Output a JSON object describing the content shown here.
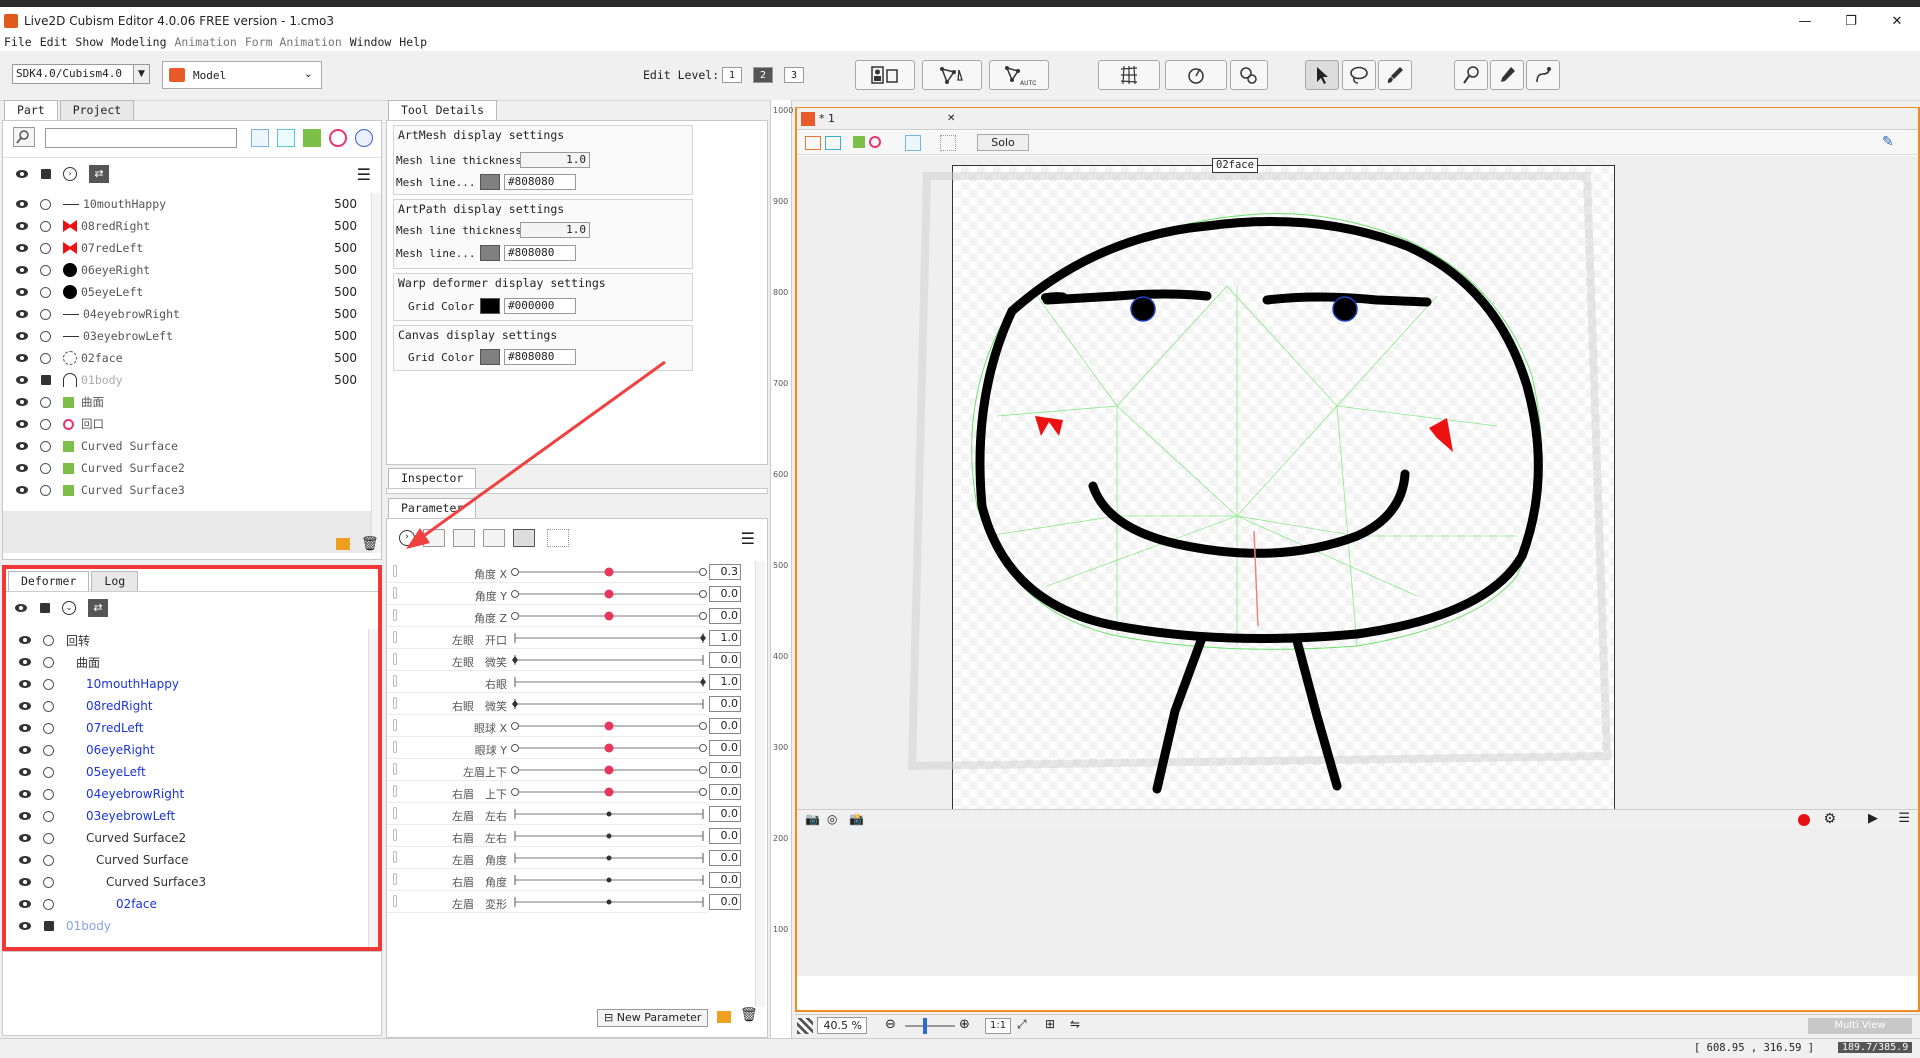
{
  "window": {
    "title": "Live2D Cubism Editor 4.0.06   FREE version  - 1.cmo3",
    "minimize": "—",
    "maximize": "❐",
    "close": "✕"
  },
  "menu": [
    "File",
    "Edit",
    "Show",
    "Modeling",
    "Animation",
    "Form Animation",
    "Window",
    "Help"
  ],
  "toolbar": {
    "sdk_select": "SDK4.0/Cubism4.0",
    "mode_select": "Model",
    "edit_level_label": "Edit Level:",
    "edit_levels": [
      "1",
      "2",
      "3"
    ],
    "edit_level_selected": "2"
  },
  "part_panel": {
    "tabs": [
      "Part",
      "Project"
    ],
    "rows": [
      {
        "name": "10mouthHappy",
        "value": "500",
        "icon": "mouth-stroke-icon"
      },
      {
        "name": "08redRight",
        "value": "500",
        "icon": "red-mark-icon"
      },
      {
        "name": "07redLeft",
        "value": "500",
        "icon": "red-mark-icon"
      },
      {
        "name": "06eyeRight",
        "value": "500",
        "icon": "black-dot-icon"
      },
      {
        "name": "05eyeLeft",
        "value": "500",
        "icon": "black-dot-icon"
      },
      {
        "name": "04eyebrowRight",
        "value": "500",
        "icon": "stroke-icon"
      },
      {
        "name": "03eyebrowLeft",
        "value": "500",
        "icon": "stroke-icon"
      },
      {
        "name": "02face",
        "value": "500",
        "icon": "dashed-circle-icon"
      },
      {
        "name": "01body",
        "value": "500",
        "icon": "body-icon"
      },
      {
        "name": "曲面",
        "value": "",
        "icon": "warp-deformer-icon"
      },
      {
        "name": "回口",
        "value": "",
        "icon": "rotation-deformer-icon"
      },
      {
        "name": "Curved Surface",
        "value": "",
        "icon": "warp-deformer-icon"
      },
      {
        "name": "Curved Surface2",
        "value": "",
        "icon": "warp-deformer-icon"
      },
      {
        "name": "Curved Surface3",
        "value": "",
        "icon": "warp-deformer-icon"
      }
    ]
  },
  "deformer_panel": {
    "tabs": [
      "Deformer",
      "Log"
    ],
    "rows": [
      {
        "name": "回转",
        "indent": 0,
        "color": "#333"
      },
      {
        "name": "曲面",
        "indent": 1,
        "color": "#333"
      },
      {
        "name": "10mouthHappy",
        "indent": 2,
        "color": "#1a35d6"
      },
      {
        "name": "08redRight",
        "indent": 2,
        "color": "#1a35d6"
      },
      {
        "name": "07redLeft",
        "indent": 2,
        "color": "#1a35d6"
      },
      {
        "name": "06eyeRight",
        "indent": 2,
        "color": "#1a35d6"
      },
      {
        "name": "05eyeLeft",
        "indent": 2,
        "color": "#1a35d6"
      },
      {
        "name": "04eyebrowRight",
        "indent": 2,
        "color": "#1a35d6"
      },
      {
        "name": "03eyebrowLeft",
        "indent": 2,
        "color": "#1a35d6"
      },
      {
        "name": "Curved Surface2",
        "indent": 2,
        "color": "#333"
      },
      {
        "name": "Curved Surface",
        "indent": 3,
        "color": "#333"
      },
      {
        "name": "Curved Surface3",
        "indent": 4,
        "color": "#333"
      },
      {
        "name": "02face",
        "indent": 5,
        "color": "#1a35d6"
      },
      {
        "name": "01body",
        "indent": 0,
        "color": "#8aa0e8"
      }
    ]
  },
  "tool_details": {
    "tab": "Tool Details",
    "artmesh_title": "ArtMesh display settings",
    "artmesh_thickness_label": "Mesh line thickness",
    "artmesh_thickness": "1.0",
    "artmesh_color_label": "Mesh line...",
    "artmesh_color": "#808080",
    "artpath_title": "ArtPath display settings",
    "artpath_thickness_label": "Mesh line thickness",
    "artpath_thickness": "1.0",
    "artpath_color_label": "Mesh line...",
    "artpath_color": "#808080",
    "warp_title": "Warp deformer display settings",
    "warp_grid_label": "Grid Color",
    "warp_grid_color": "#000000",
    "canvas_title": "Canvas display settings",
    "canvas_grid_label": "Grid Color",
    "canvas_grid_color": "#808080"
  },
  "inspector": {
    "tab": "Inspector"
  },
  "parameter": {
    "tab": "Parameter",
    "new_button": "New Parameter",
    "rows": [
      {
        "name": "角度 X",
        "value": "0.3",
        "pos": 0.5,
        "type": "center"
      },
      {
        "name": "角度 Y",
        "value": "0.0",
        "pos": 0.5,
        "type": "center"
      },
      {
        "name": "角度 Z",
        "value": "0.0",
        "pos": 0.5,
        "type": "center"
      },
      {
        "name": "左眼　开口",
        "value": "1.0",
        "pos": 1.0,
        "type": "end"
      },
      {
        "name": "左眼　微笑",
        "value": "0.0",
        "pos": 0.0,
        "type": "end"
      },
      {
        "name": "右眼",
        "value": "1.0",
        "pos": 1.0,
        "type": "end"
      },
      {
        "name": "右眼　微笑",
        "value": "0.0",
        "pos": 0.0,
        "type": "end"
      },
      {
        "name": "眼球 X",
        "value": "0.0",
        "pos": 0.5,
        "type": "center"
      },
      {
        "name": "眼球 Y",
        "value": "0.0",
        "pos": 0.5,
        "type": "center"
      },
      {
        "name": "左眉上下",
        "value": "0.0",
        "pos": 0.5,
        "type": "center"
      },
      {
        "name": "右眉　上下",
        "value": "0.0",
        "pos": 0.5,
        "type": "center"
      },
      {
        "name": "左眉　左右",
        "value": "0.0",
        "pos": 0.5,
        "type": "plain"
      },
      {
        "name": "右眉　左右",
        "value": "0.0",
        "pos": 0.5,
        "type": "plain"
      },
      {
        "name": "左眉　角度",
        "value": "0.0",
        "pos": 0.5,
        "type": "plain"
      },
      {
        "name": "右眉　角度",
        "value": "0.0",
        "pos": 0.5,
        "type": "plain"
      },
      {
        "name": "左眉　変形",
        "value": "0.0",
        "pos": 0.5,
        "type": "plain"
      }
    ]
  },
  "ruler": [
    "1000",
    "900",
    "800",
    "700",
    "600",
    "500",
    "400",
    "300",
    "200",
    "100"
  ],
  "viewport": {
    "tab": "* 1",
    "solo": "Solo",
    "selected_label": "02face",
    "zoom": "40.5 %",
    "one_to_one": "1:1",
    "multi_view": "Multi View"
  },
  "status": {
    "coords": "[  608.95 ,  316.59  ]",
    "extra": "189.7/385.9"
  }
}
